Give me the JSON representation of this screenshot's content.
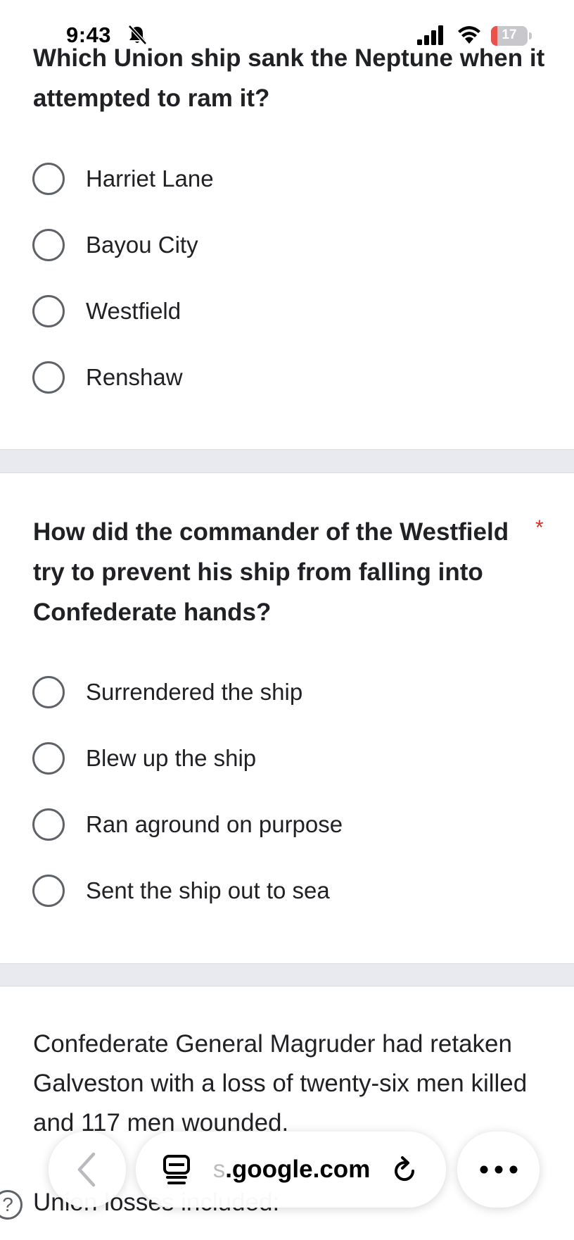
{
  "status_bar": {
    "time": "9:43",
    "battery_level": "17",
    "battery_fraction": 0.17
  },
  "question1": {
    "text": "Which Union ship sank the Neptune when it attempted to ram it?",
    "options": [
      "Harriet Lane",
      "Bayou City",
      "Westfield",
      "Renshaw"
    ]
  },
  "question2": {
    "text": "How did the commander of the Westfield try to prevent his ship from falling into Confederate hands?",
    "required_marker": "*",
    "options": [
      "Surrendered the ship",
      "Blew up the ship",
      "Ran aground on purpose",
      "Sent the ship out to sea"
    ]
  },
  "info": {
    "paragraph": "Confederate General Magruder had retaken Galveston with a loss of twenty-six men killed and 117 men wounded.",
    "next_line": "Union losses included:"
  },
  "help": {
    "icon": "?"
  },
  "browser_bar": {
    "url_prefix": "s",
    "url": ".google.com",
    "colors": {
      "accent": "#000000"
    }
  }
}
